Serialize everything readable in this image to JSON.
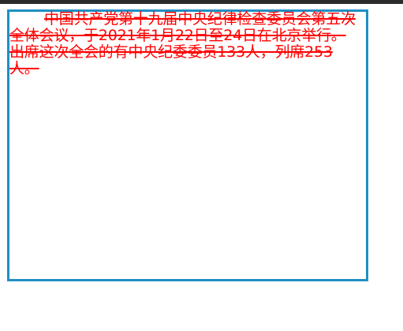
{
  "colors": {
    "text": "#ff0000",
    "frame_border": "#1f8fc4",
    "top_bar": "#2b2b2b",
    "background": "#ffffff"
  },
  "content": {
    "paragraph": "中国共产党第十九届中央纪律检查委员会第五次全体会议，于2021年1月22日至24日在北京举行。出席这次全会的有中央纪委委员133人，列席253人。"
  }
}
